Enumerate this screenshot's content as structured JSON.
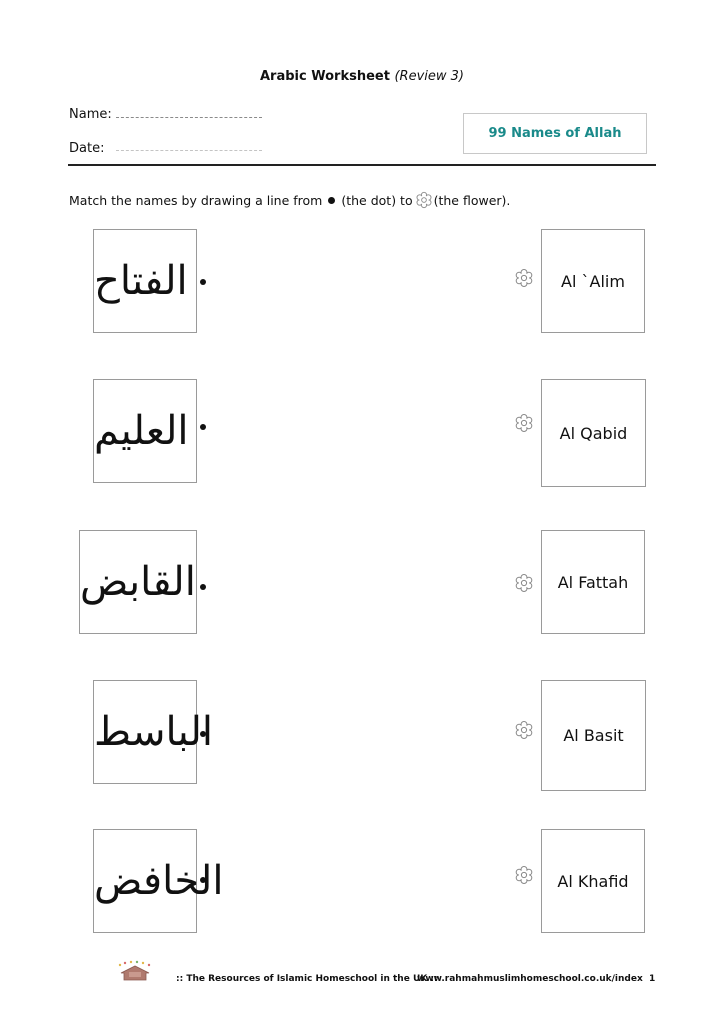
{
  "header": {
    "title_main": "Arabic Worksheet",
    "title_sub": "(Review 3)",
    "name_label": "Name:",
    "date_label": "Date:",
    "topic": "99 Names of Allah",
    "accent_color": "#1a8a8a"
  },
  "instruction": {
    "part1": "Match the names by drawing a line from",
    "dot_icon": "bullet-dot",
    "part2": "(the dot) to",
    "flower_icon": "flower-outline",
    "part3": "(the flower)."
  },
  "rows": [
    {
      "arabic": "الفتاح",
      "english": "Al `Alim"
    },
    {
      "arabic": "العليم",
      "english": "Al Qabid"
    },
    {
      "arabic": "القابض",
      "english": "Al Fattah"
    },
    {
      "arabic": "الباسط",
      "english": "Al Basit"
    },
    {
      "arabic": "الخافض",
      "english": "Al Khafid"
    }
  ],
  "footer": {
    "logo": "house-logo",
    "org": ":: The Resources of Islamic Homeschool in the UK ::",
    "url": "www.rahmahmuslimhomeschool.co.uk/index",
    "page": "1"
  }
}
